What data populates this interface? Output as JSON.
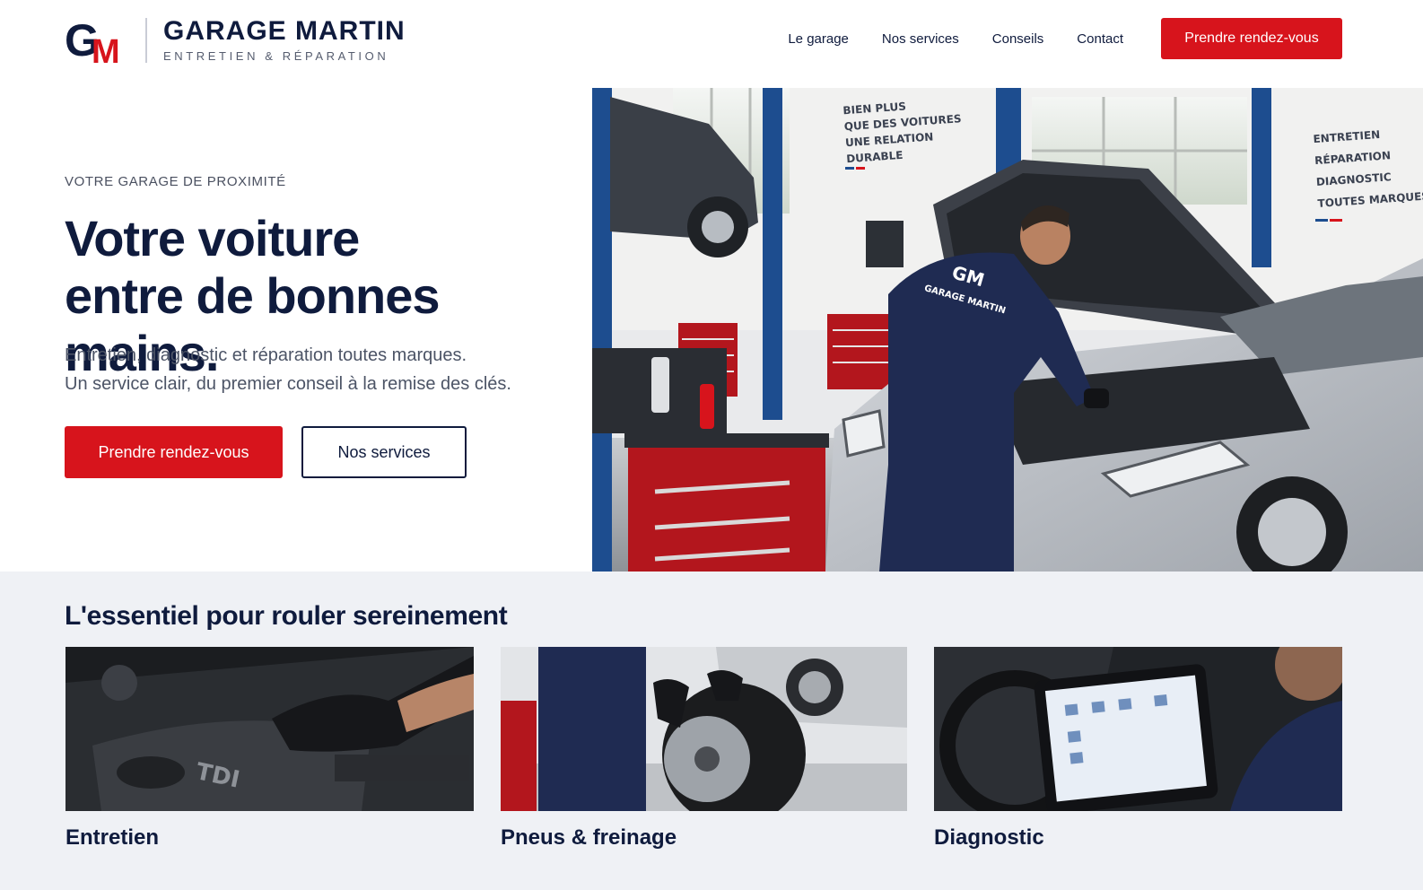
{
  "brand": {
    "mark_letters": [
      "G",
      "M"
    ],
    "name": "GARAGE MARTIN",
    "tagline": "ENTRETIEN & RÉPARATION"
  },
  "nav": {
    "items": [
      {
        "label": "Le garage"
      },
      {
        "label": "Nos services"
      },
      {
        "label": "Conseils"
      },
      {
        "label": "Contact"
      }
    ],
    "cta_label": "Prendre rendez-vous"
  },
  "hero": {
    "eyebrow": "VOTRE GARAGE DE PROXIMITÉ",
    "headline_line1": "Votre voiture",
    "headline_line2": "entre de bonnes mains.",
    "lede_line1": "Entretien, diagnostic et réparation toutes marques.",
    "lede_line2": "Un service clair, du premier conseil à la remise des clés.",
    "primary_label": "Prendre rendez-vous",
    "secondary_label": "Nos services",
    "photo": {
      "wall_sign_1": [
        "BIEN PLUS",
        "QUE DES VOITURES",
        "UNE RELATION",
        "DURABLE"
      ],
      "wall_sign_2": [
        "ENTRETIEN",
        "RÉPARATION",
        "DIAGNOSTIC",
        "TOUTES MARQUES"
      ],
      "uniform_text": "GARAGE MARTIN",
      "uniform_mark": "GM"
    }
  },
  "services": {
    "title": "L'essentiel pour rouler sereinement",
    "cards": [
      {
        "title": "Entretien",
        "image_text": "TDI"
      },
      {
        "title": "Pneus & freinage"
      },
      {
        "title": "Diagnostic"
      }
    ]
  },
  "colors": {
    "navy": "#0f1b3d",
    "red": "#d7141c",
    "section_bg": "#eff1f5"
  }
}
